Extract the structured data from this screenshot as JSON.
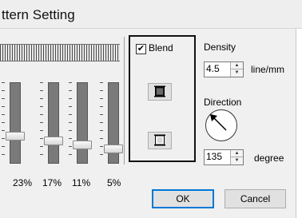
{
  "window": {
    "title": "ttern Setting"
  },
  "sliders": [
    {
      "percent_label": "23%",
      "level": 0.23
    },
    {
      "percent_label": "17%",
      "level": 0.17
    },
    {
      "percent_label": "11%",
      "level": 0.11
    },
    {
      "percent_label": "5%",
      "level": 0.05
    }
  ],
  "blend": {
    "label": "Blend",
    "checked": true,
    "check_mark": "✔",
    "buttons": [
      {
        "icon": "pattern-square-dark-icon"
      },
      {
        "icon": "pattern-square-light-icon"
      }
    ]
  },
  "density": {
    "label": "Density",
    "value": "4.5",
    "unit": "line/mm"
  },
  "direction": {
    "label": "Direction",
    "value": "135",
    "unit": "degree"
  },
  "buttons": {
    "ok_label": "OK",
    "cancel_label": "Cancel"
  }
}
